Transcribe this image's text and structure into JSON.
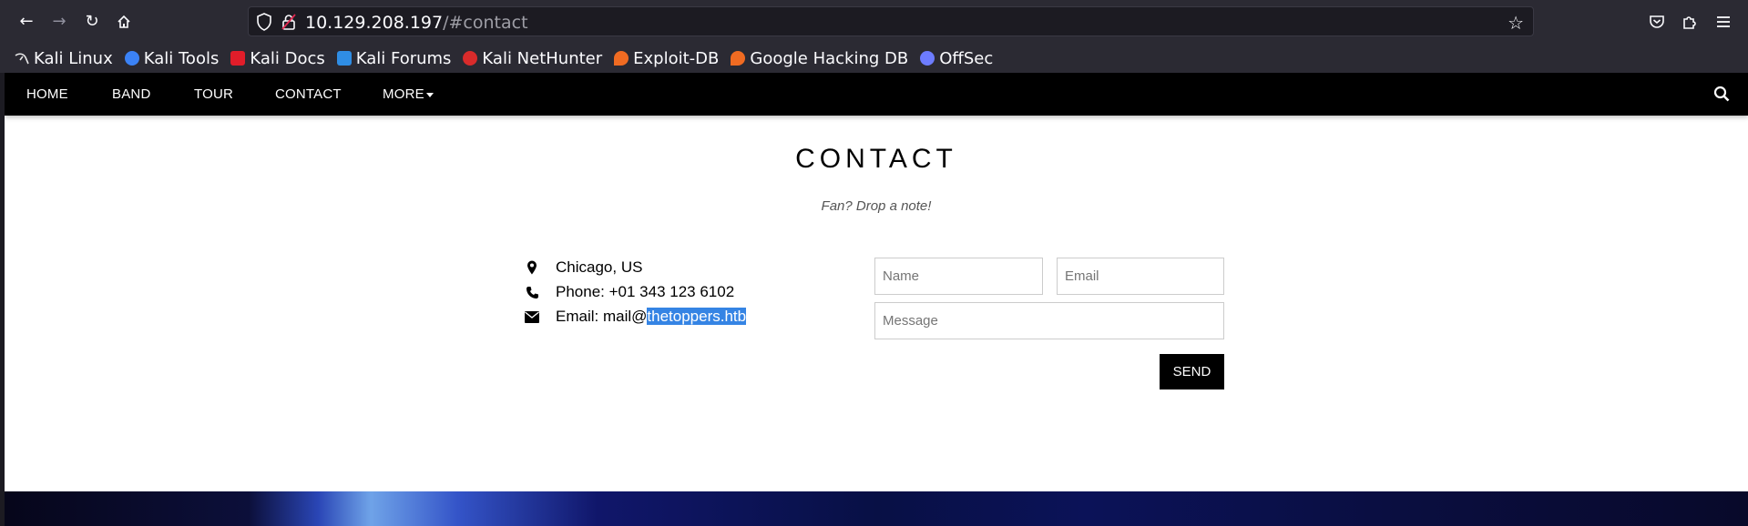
{
  "browser": {
    "url_host": "10.129.208.197",
    "url_path": "/#contact",
    "bookmarks": [
      {
        "label": "Kali Linux",
        "icon": "kali-dragon-icon",
        "color": "#e8e8e8"
      },
      {
        "label": "Kali Tools",
        "icon": "kali-tools-icon",
        "color": "#3b82f6"
      },
      {
        "label": "Kali Docs",
        "icon": "kali-docs-icon",
        "color": "#e11d2a"
      },
      {
        "label": "Kali Forums",
        "icon": "kali-forums-icon",
        "color": "#2f8de4"
      },
      {
        "label": "Kali NetHunter",
        "icon": "kali-nethunter-icon",
        "color": "#d92b2b"
      },
      {
        "label": "Exploit-DB",
        "icon": "exploit-db-icon",
        "color": "#f06b22"
      },
      {
        "label": "Google Hacking DB",
        "icon": "ghdb-icon",
        "color": "#f06b22"
      },
      {
        "label": "OffSec",
        "icon": "offsec-icon",
        "color": "#6d7cff"
      }
    ]
  },
  "nav": {
    "home": "HOME",
    "band": "BAND",
    "tour": "TOUR",
    "contact": "CONTACT",
    "more": "MORE"
  },
  "contact": {
    "title": "CONTACT",
    "subtitle": "Fan? Drop a note!",
    "location": "Chicago, US",
    "phone": "Phone: +01 343 123 6102",
    "email_prefix": "Email: mail@",
    "email_domain": "thetoppers.htb",
    "form": {
      "name_placeholder": "Name",
      "email_placeholder": "Email",
      "message_placeholder": "Message",
      "send_label": "SEND"
    }
  },
  "colors": {
    "selection": "#3584e4",
    "navbar": "#000000"
  }
}
